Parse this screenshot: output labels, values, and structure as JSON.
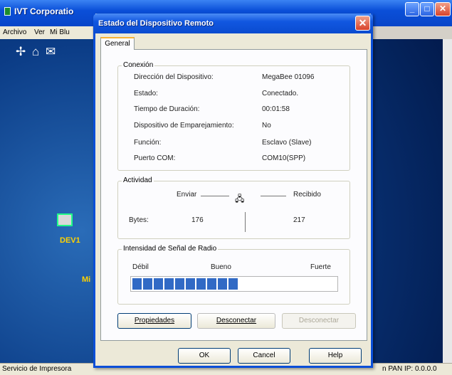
{
  "background_window": {
    "title": "IVT Corporatio",
    "menu": [
      "Archivo",
      "Ver",
      "Mi Blu"
    ],
    "device_label": "DEV1",
    "me_label": "Mi",
    "status_left": "Servicio de Impresora",
    "status_right": "n PAN IP: 0.0.0.0"
  },
  "dialog": {
    "title": "Estado del Dispositivo Remoto",
    "tabs": [
      "General"
    ],
    "conexion": {
      "legend": "Conexión",
      "rows": [
        {
          "label": "Dirección del Dispositivo:",
          "value": "MegaBee 01096"
        },
        {
          "label": "Estado:",
          "value": "Conectado."
        },
        {
          "label": "Tiempo de Duración:",
          "value": "00:01:58"
        },
        {
          "label": "Dispositivo de Emparejamiento:",
          "value": "No"
        },
        {
          "label": "Función:",
          "value": "Esclavo (Slave)"
        },
        {
          "label": "Puerto COM:",
          "value": "COM10(SPP)"
        }
      ]
    },
    "actividad": {
      "legend": "Actividad",
      "sent_label": "Enviar",
      "received_label": "Recibido",
      "bytes_label": "Bytes:",
      "bytes_sent": "176",
      "bytes_received": "217"
    },
    "senal": {
      "legend": "Intensidad de Señal de Radio",
      "low": "Débil",
      "mid": "Bueno",
      "high": "Fuerte",
      "level_fraction": 0.53
    },
    "buttons": {
      "properties": "Propiedades",
      "disconnect": "Desconectar",
      "disabled": "Desconectar",
      "ok": "OK",
      "cancel": "Cancel",
      "help": "Help"
    },
    "colors": {
      "signal": "#316ac5",
      "titlebar": "#0a4fd8"
    }
  }
}
